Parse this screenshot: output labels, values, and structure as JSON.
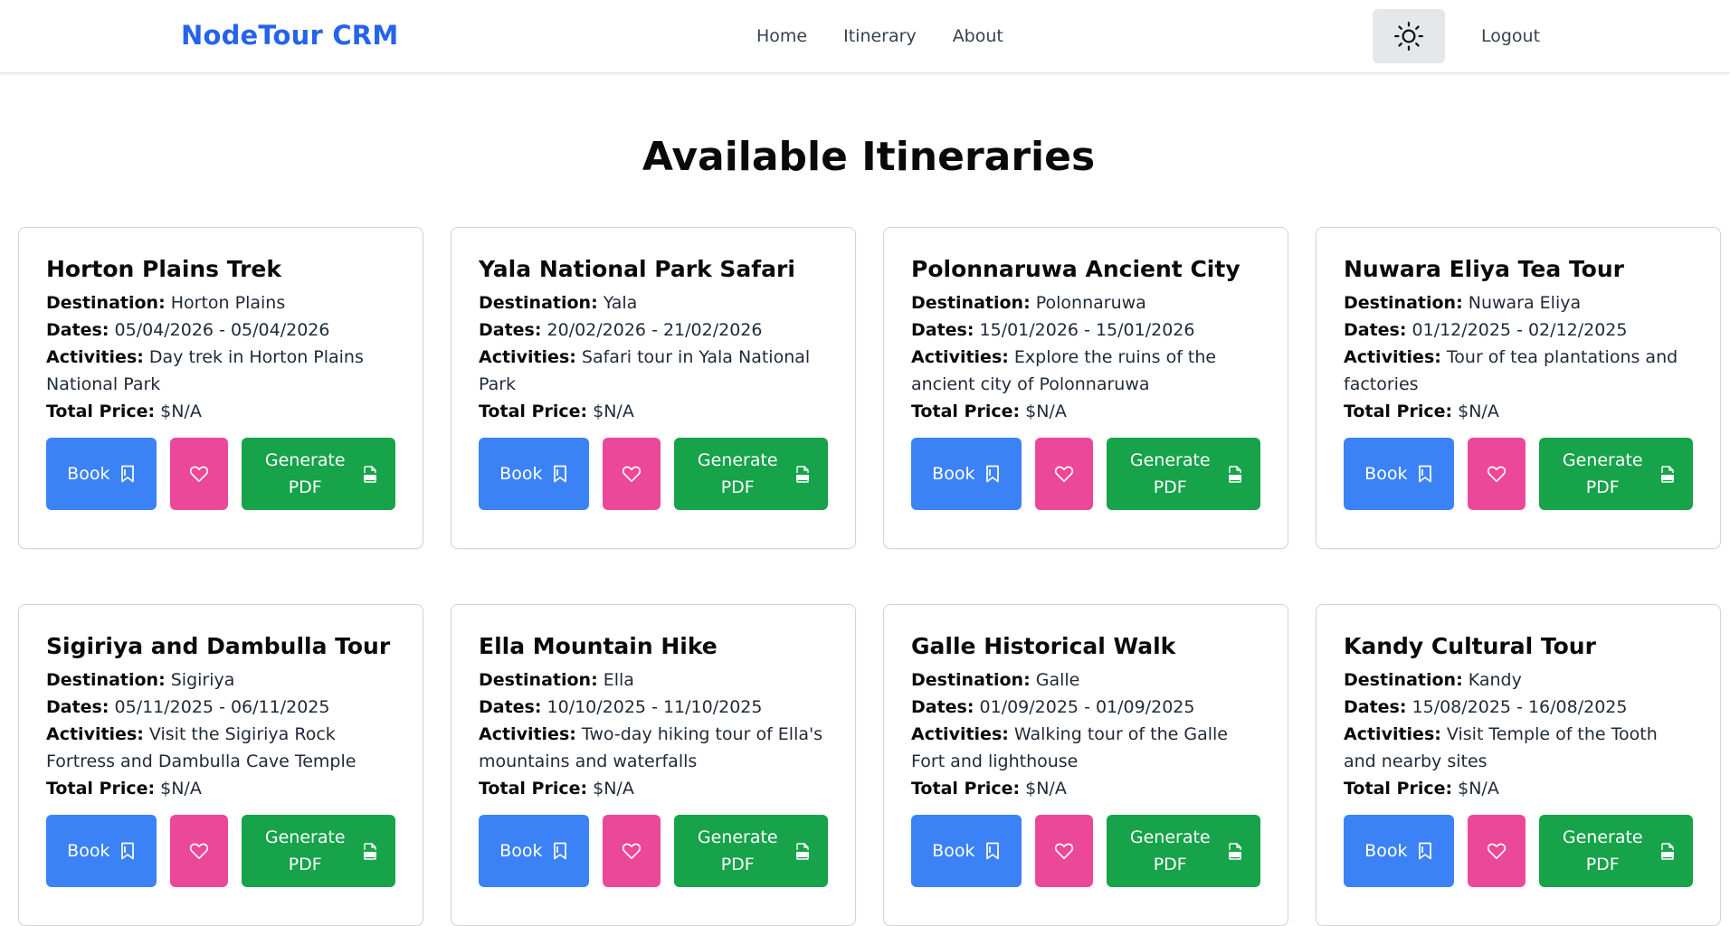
{
  "header": {
    "brand": "NodeTour CRM",
    "nav": [
      "Home",
      "Itinerary",
      "About"
    ],
    "theme_icon": "sun-icon",
    "logout": "Logout"
  },
  "page_title": "Available Itineraries",
  "labels": {
    "destination": "Destination:",
    "dates": "Dates:",
    "activities": "Activities:",
    "total_price": "Total Price:",
    "book": "Book",
    "generate_pdf_line1": "Generate",
    "generate_pdf_line2": "PDF"
  },
  "colors": {
    "brand": "#2563eb",
    "book": "#3b82f6",
    "favorite": "#ec4899",
    "pdf": "#16a34a"
  },
  "itineraries": [
    {
      "title": "Horton Plains Trek",
      "destination": "Horton Plains",
      "dates": "05/04/2026 - 05/04/2026",
      "activities": "Day trek in Horton Plains National Park",
      "price": "$N/A"
    },
    {
      "title": "Yala National Park Safari",
      "destination": "Yala",
      "dates": "20/02/2026 - 21/02/2026",
      "activities": "Safari tour in Yala National Park",
      "price": "$N/A"
    },
    {
      "title": "Polonnaruwa Ancient City",
      "destination": "Polonnaruwa",
      "dates": "15/01/2026 - 15/01/2026",
      "activities": "Explore the ruins of the ancient city of Polonnaruwa",
      "price": "$N/A"
    },
    {
      "title": "Nuwara Eliya Tea Tour",
      "destination": "Nuwara Eliya",
      "dates": "01/12/2025 - 02/12/2025",
      "activities": "Tour of tea plantations and factories",
      "price": "$N/A"
    },
    {
      "title": "Sigiriya and Dambulla Tour",
      "destination": "Sigiriya",
      "dates": "05/11/2025 - 06/11/2025",
      "activities": "Visit the Sigiriya Rock Fortress and Dambulla Cave Temple",
      "price": "$N/A"
    },
    {
      "title": "Ella Mountain Hike",
      "destination": "Ella",
      "dates": "10/10/2025 - 11/10/2025",
      "activities": "Two-day hiking tour of Ella's mountains and waterfalls",
      "price": "$N/A"
    },
    {
      "title": "Galle Historical Walk",
      "destination": "Galle",
      "dates": "01/09/2025 - 01/09/2025",
      "activities": "Walking tour of the Galle Fort and lighthouse",
      "price": "$N/A"
    },
    {
      "title": "Kandy Cultural Tour",
      "destination": "Kandy",
      "dates": "15/08/2025 - 16/08/2025",
      "activities": "Visit Temple of the Tooth and nearby sites",
      "price": "$N/A"
    }
  ]
}
